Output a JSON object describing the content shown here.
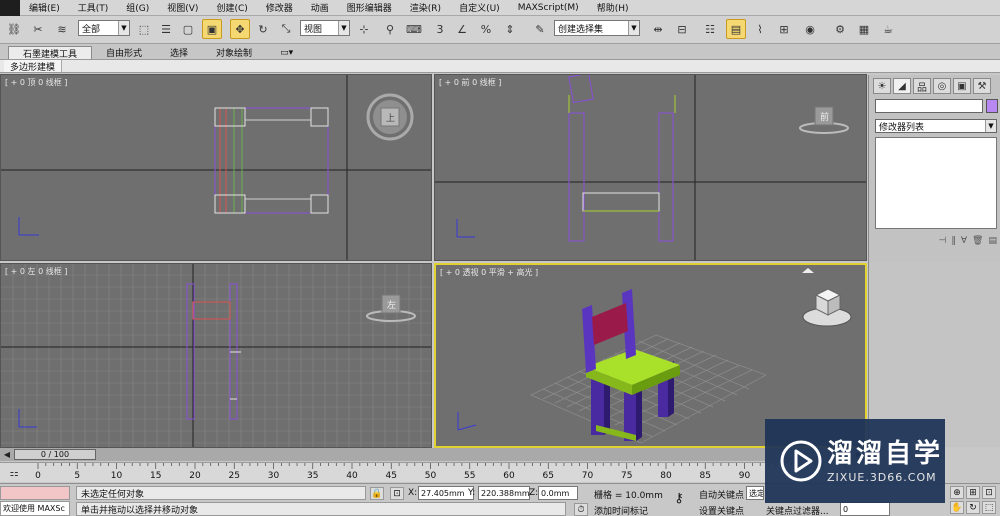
{
  "menubar": {
    "items": [
      "编辑(E)",
      "工具(T)",
      "组(G)",
      "视图(V)",
      "创建(C)",
      "修改器",
      "动画",
      "图形编辑器",
      "渲染(R)",
      "自定义(U)",
      "MAXScript(M)",
      "帮助(H)"
    ]
  },
  "toolbar": {
    "selection_filter": "全部",
    "reference_coord": "视图",
    "named_selection_set": "创建选择集",
    "snap_label": "3"
  },
  "ribbon": {
    "tabs": [
      "石墨建模工具",
      "自由形式",
      "选择",
      "对象绘制"
    ],
    "sub_tab": "多边形建模"
  },
  "viewports": {
    "top": {
      "label": "[ + 0 顶 0 线框 ]",
      "cube": "上"
    },
    "front": {
      "label": "[ + 0 前 0 线框 ]",
      "cube": "前"
    },
    "left": {
      "label": "[ + 0 左 0 线框 ]",
      "cube": "左"
    },
    "perspective": {
      "label": "[ + 0 透视 0 平滑 + 高光 ]"
    }
  },
  "command_panel": {
    "modifier_list": "修改器列表",
    "tab_icons": [
      "create-icon",
      "modify-icon",
      "hierarchy-icon",
      "motion-icon",
      "display-icon",
      "utilities-icon"
    ]
  },
  "timeline": {
    "frame_display": "0 / 100",
    "ticks": [
      "0",
      "5",
      "10",
      "15",
      "20",
      "25",
      "30",
      "35",
      "40",
      "45",
      "50",
      "55",
      "60",
      "65",
      "70",
      "75",
      "80",
      "85",
      "90"
    ]
  },
  "status": {
    "maxscript_label": "欢迎使用 MAXSc",
    "selection_text": "未选定任何对象",
    "prompt_text": "单击并拖动以选择并移动对象",
    "x_label": "X:",
    "x_value": "27.405mm",
    "y_label": "Y:",
    "y_value": "220.388mm",
    "z_label": "Z:",
    "z_value": "0.0mm",
    "grid_text": "栅格 = 10.0mm",
    "auto_key": "自动关键点",
    "set_key": "设置关键点",
    "selected_dropdown": "选定",
    "key_filter": "关键点过滤器...",
    "add_time_tag": "添加时间标记",
    "frame_value": "0"
  },
  "watermark": {
    "title": "溜溜自学",
    "subtitle": "ZIXUE.3D66.COM"
  }
}
